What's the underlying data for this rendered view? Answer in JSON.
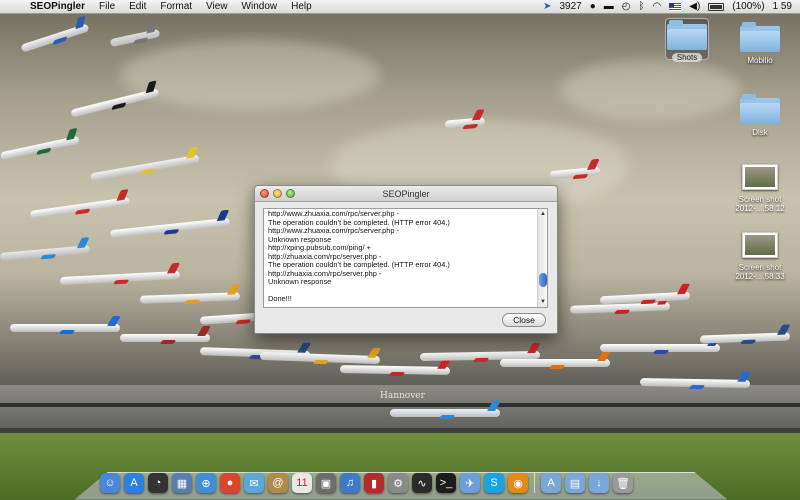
{
  "menubar": {
    "apple_glyph": "",
    "app_name": "SEOPingler",
    "menus": [
      "File",
      "Edit",
      "Format",
      "View",
      "Window",
      "Help"
    ],
    "status": {
      "counter": "3927",
      "battery_text": "(100%)",
      "clock": "1 59"
    }
  },
  "wallpaper": {
    "sign": "Hannover"
  },
  "desktop_icons": [
    {
      "label": "Shots",
      "kind": "folder",
      "selected": true
    },
    {
      "label": "Mobilio",
      "kind": "folder"
    },
    {
      "label": "Disk",
      "kind": "folder"
    },
    {
      "label": "Screen shot 2012-....58.12",
      "kind": "screenshot"
    },
    {
      "label": "Screen shot 2012-....58.33",
      "kind": "screenshot"
    }
  ],
  "window": {
    "title": "SEOPingler",
    "log_lines": [
      "http://www.zhuaxia.com/rpc/server.php -",
      "The operation couldn’t be completed. (HTTP error 404.)",
      "http://www.zhuaxia.com/rpc/server.php -",
      "Unknown response",
      "http://xping.pubsub.com/ping/ +",
      "http://zhuaxia.com/rpc/server.php -",
      "The operation couldn’t be completed. (HTTP error 404.)",
      "http://zhuaxia.com/rpc/server.php -",
      "Unknown response",
      "",
      "Done!!!"
    ],
    "close_label": "Close"
  },
  "dock": {
    "items": [
      {
        "name": "finder-icon",
        "glyph": "☺",
        "color": "#4a86d8"
      },
      {
        "name": "app-store-icon",
        "glyph": "A",
        "color": "#2d7fe0"
      },
      {
        "name": "dashboard-icon",
        "glyph": "◔",
        "color": "#333333"
      },
      {
        "name": "preview-icon",
        "glyph": "▦",
        "color": "#5a7db0"
      },
      {
        "name": "safari-icon",
        "glyph": "⊕",
        "color": "#3e8fd8"
      },
      {
        "name": "chrome-icon",
        "glyph": "●",
        "color": "#d9472b"
      },
      {
        "name": "skype-app-icon",
        "glyph": "✉",
        "color": "#5aa8d8"
      },
      {
        "name": "address-book-icon",
        "glyph": "@",
        "color": "#b08a4a"
      },
      {
        "name": "calendar-icon",
        "glyph": "11",
        "color": "#e8e8e8"
      },
      {
        "name": "photos-icon",
        "glyph": "▣",
        "color": "#6d6d6d"
      },
      {
        "name": "itunes-icon",
        "glyph": "♫",
        "color": "#3f7ac9"
      },
      {
        "name": "photo-booth-icon",
        "glyph": "▮",
        "color": "#b52a2a"
      },
      {
        "name": "system-preferences-icon",
        "glyph": "⚙",
        "color": "#8a8a8a"
      },
      {
        "name": "activity-monitor-icon",
        "glyph": "∿",
        "color": "#2b2b2b"
      },
      {
        "name": "terminal-icon",
        "glyph": ">_",
        "color": "#1c1c1c"
      },
      {
        "name": "mail-icon",
        "glyph": "✈",
        "color": "#6aa0d6"
      },
      {
        "name": "skype-icon",
        "glyph": "S",
        "color": "#1aa3e0"
      },
      {
        "name": "rss-icon",
        "glyph": "◉",
        "color": "#e08a1a"
      },
      {
        "name": "applications-folder-icon",
        "glyph": "A",
        "color": "#7aa7d8"
      },
      {
        "name": "documents-folder-icon",
        "glyph": "▤",
        "color": "#7aa7d8"
      },
      {
        "name": "downloads-folder-icon",
        "glyph": "↓",
        "color": "#7aa7d8"
      },
      {
        "name": "trash-icon",
        "glyph": "🗑",
        "color": "#9a9a9a"
      }
    ]
  }
}
